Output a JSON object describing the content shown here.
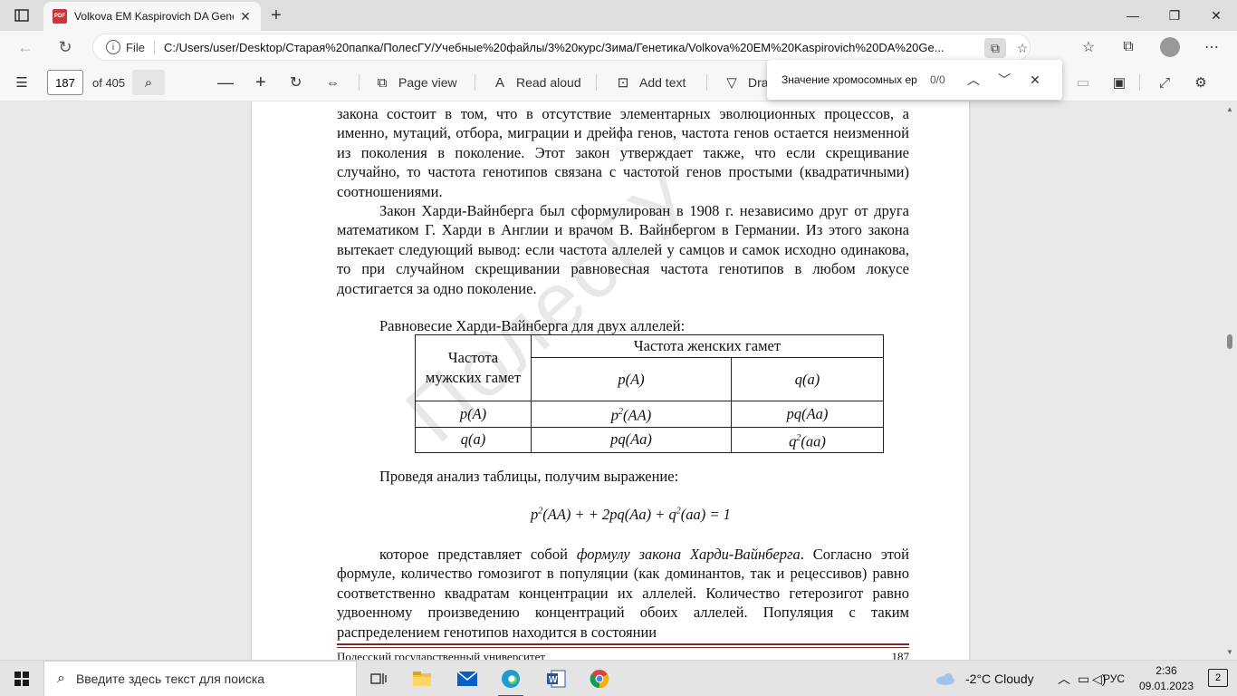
{
  "browser": {
    "tab_title": "Volkova EM Kaspirovich DA Gene",
    "url_scheme": "File",
    "url_path": "C:/Users/user/Desktop/Старая%20папка/ПолесГУ/Учебные%20файлы/3%20курс/Зима/Генетика/Volkova%20EM%20Kaspirovich%20DA%20Ge...",
    "favicon_text": "PDF"
  },
  "pdf_toolbar": {
    "page_number": "187",
    "page_total": "of 405",
    "page_view_label": "Page view",
    "read_aloud_label": "Read aloud",
    "add_text_label": "Add text",
    "draw_label": "Dra"
  },
  "find": {
    "query": "Значение хромосомных ер",
    "count": "0/0"
  },
  "document": {
    "para1": "закона состоит в том, что в отсутствие элементарных эволюционных процессов, а именно, мутаций, отбора, миграции и дрейфа генов, частота генов остается неизменной из поколения в поколение. Этот закон утверждает также, что если скрещивание случайно, то частота генотипов связана с частотой генов простыми (квадратичными) соотношениями.",
    "para2": "Закон Харди-Вайнберга был сформулирован в 1908 г. независимо друг от друга математиком Г. Харди в Англии и врачом В. Вайнбергом в Германии. Из этого закона вытекает следующий вывод: если частота аллелей у самцов и самок исходно одинакова, то при случайном скрещивании равновесная частота генотипов в любом локусе достигается за одно поколение.",
    "table_caption": "Равновесие Харди-Вайнберга для двух аллелей:",
    "table": {
      "corner_header": "Частота мужских гамет",
      "female_header": "Частота женских гамет",
      "col1": "p(A)",
      "col2": "q(a)",
      "rows": [
        {
          "label": "p(A)",
          "c1_pre": "p",
          "c1_sup": "2",
          "c1_post": "(AA)",
          "c2": "pq(Aa)"
        },
        {
          "label": "q(a)",
          "c1": "pq(Aa)",
          "c2_pre": "q",
          "c2_sup": "2",
          "c2_post": "(aa)"
        }
      ]
    },
    "analysis": "Проведя анализ таблицы, получим выражение:",
    "formula": {
      "p": "p",
      "sup1": "2",
      "mid": "(AA) + + 2pq(Aa) + q",
      "sup2": "2",
      "end": "(aa) = 1"
    },
    "para3_start": "которое представляет собой ",
    "para3_italic": "формулу закона Харди-Вайнберга",
    "para3_rest": ". Согласно этой формуле, количество гомозигот в популяции (как доминантов, так и рецессивов) равно соответственно квадратам концентрации их аллелей. Количество гетерозигот равно удвоенному произведению концентраций обоих аллелей. Популяция с таким распределением генотипов находится в состоянии",
    "footer_text": "Полесский государственный университет",
    "footer_page": "187",
    "watermark": "ПолесГУ"
  },
  "taskbar": {
    "search_placeholder": "Введите здесь текст для поиска",
    "weather": "-2°C  Cloudy",
    "language": "РУС",
    "time": "2:36",
    "date": "09.01.2023",
    "notifications": "2"
  }
}
